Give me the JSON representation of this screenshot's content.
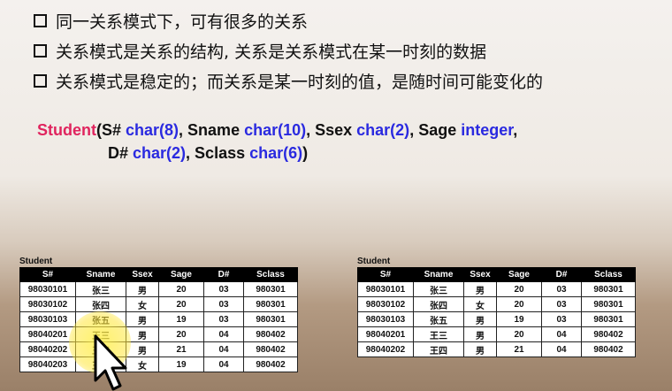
{
  "bullets": [
    "同一关系模式下，可有很多的关系",
    "关系模式是关系的结构, 关系是关系模式在某一时刻的数据",
    "关系模式是稳定的；而关系是某一时刻的值，是随时间可能变化的"
  ],
  "schema": {
    "relation": "Student",
    "line1": [
      {
        "t": "(S# ",
        "c": "plain"
      },
      {
        "t": "char(8)",
        "c": "type"
      },
      {
        "t": ", Sname ",
        "c": "plain"
      },
      {
        "t": "char(10)",
        "c": "type"
      },
      {
        "t": ", Ssex ",
        "c": "plain"
      },
      {
        "t": "char(2)",
        "c": "type"
      },
      {
        "t": ", Sage ",
        "c": "plain"
      },
      {
        "t": "integer",
        "c": "type"
      },
      {
        "t": ",",
        "c": "plain"
      }
    ],
    "line2": [
      {
        "t": "D# ",
        "c": "plain"
      },
      {
        "t": "char(2)",
        "c": "type"
      },
      {
        "t": ",  Sclass ",
        "c": "plain"
      },
      {
        "t": "char(6)",
        "c": "type"
      },
      {
        "t": ")",
        "c": "plain"
      }
    ]
  },
  "table_left": {
    "title": "Student",
    "columns": [
      "S#",
      "Sname",
      "Ssex",
      "Sage",
      "D#",
      "Sclass"
    ],
    "rows": [
      [
        "98030101",
        "张三",
        "男",
        "20",
        "03",
        "980301"
      ],
      [
        "98030102",
        "张四",
        "女",
        "20",
        "03",
        "980301"
      ],
      [
        "98030103",
        "张五",
        "男",
        "19",
        "03",
        "980301"
      ],
      [
        "98040201",
        "王三",
        "男",
        "20",
        "04",
        "980402"
      ],
      [
        "98040202",
        "王四",
        "男",
        "21",
        "04",
        "980402"
      ],
      [
        "98040203",
        "王五",
        "女",
        "19",
        "04",
        "980402"
      ]
    ]
  },
  "table_right": {
    "title": "Student",
    "columns": [
      "S#",
      "Sname",
      "Ssex",
      "Sage",
      "D#",
      "Sclass"
    ],
    "rows": [
      [
        "98030101",
        "张三",
        "男",
        "20",
        "03",
        "980301"
      ],
      [
        "98030102",
        "张四",
        "女",
        "20",
        "03",
        "980301"
      ],
      [
        "98030103",
        "张五",
        "男",
        "19",
        "03",
        "980301"
      ],
      [
        "98040201",
        "王三",
        "男",
        "20",
        "04",
        "980402"
      ],
      [
        "98040202",
        "王四",
        "男",
        "21",
        "04",
        "980402"
      ]
    ]
  },
  "colors": {
    "relation": "#e0245e",
    "type": "#2a2ae0",
    "header_bg": "#000000"
  }
}
